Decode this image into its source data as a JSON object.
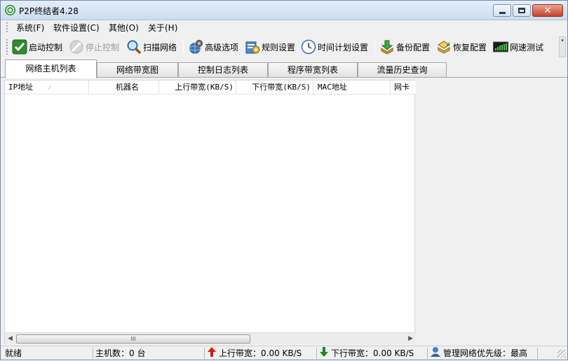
{
  "window": {
    "title": "P2P终结者4.28"
  },
  "menu": [
    "系统(F)",
    "软件设置(C)",
    "其他(O)",
    "关于(H)"
  ],
  "toolbar": {
    "start": "启动控制",
    "stop": "停止控制",
    "scan": "扫描网络",
    "advanced": "高级选项",
    "rules": "规则设置",
    "schedule": "时间计划设置",
    "backup": "备份配置",
    "restore": "恢复配置",
    "speedtest": "网速测试"
  },
  "tabs": [
    "网络主机列表",
    "网络带宽图",
    "控制日志列表",
    "程序带宽列表",
    "流量历史查询"
  ],
  "active_tab": 0,
  "columns": [
    "IP地址",
    "机器名",
    "上行带宽(KB/S)",
    "下行带宽(KB/S)",
    "MAC地址",
    "网卡"
  ],
  "scrollbar": {
    "thumb_glyph": "III"
  },
  "status": {
    "state": "就绪",
    "hosts": "主机数：0 台",
    "upload": "上行带宽：0.00 KB/S",
    "download": "下行带宽：0.00 KB/S",
    "priority": "管理网络优先级：最高"
  },
  "colors": {
    "titlebar": "#d4e2f3",
    "close_button": "#c7432a",
    "upload_arrow": "#d81e06",
    "download_arrow": "#1a8a1a"
  }
}
